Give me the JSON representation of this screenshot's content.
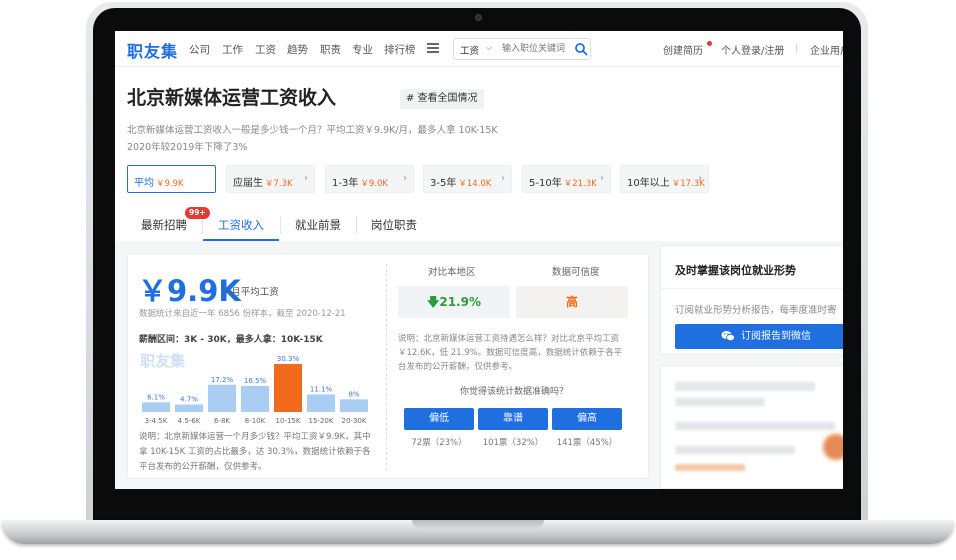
{
  "nav": {
    "logo": "职友集",
    "links": [
      "公司",
      "工作",
      "工资",
      "趋势",
      "职责",
      "专业",
      "排行榜"
    ],
    "search": {
      "category": "工资",
      "placeholder": "输入职位关键词"
    },
    "create_resume": "创建简历",
    "login": "个人登录/注册",
    "divider": "|",
    "enterprise": "企业用户"
  },
  "header": {
    "title": "北京新媒体运营工资收入",
    "national_button": "# 查看全国情况",
    "summary_line1": "北京新媒体运营工资收入一般是多少钱一个月？平均工资￥9.9K/月，最多人拿 10K-15K",
    "summary_line2": "2020年较2019年下降了3%"
  },
  "experience_tabs": [
    {
      "name": "平均",
      "value": "￥9.9K",
      "active": true
    },
    {
      "name": "应届生",
      "value": "￥7.3K"
    },
    {
      "name": "1-3年",
      "value": "￥9.0K"
    },
    {
      "name": "3-5年",
      "value": "￥14.0K"
    },
    {
      "name": "5-10年",
      "value": "￥21.3K"
    },
    {
      "name": "10年以上",
      "value": "￥17.3K"
    }
  ],
  "section_tabs": {
    "items": [
      "最新招聘",
      "工资收入",
      "就业前景",
      "岗位职责"
    ],
    "active_index": 1,
    "badge": "99+"
  },
  "salary": {
    "big_value": "￥9.9K",
    "unit": "/ 月平均工资",
    "sample_note": "数据统计来自近一年 6856 份样本，截至 2020-12-21",
    "range_title": "薪酬区间：3K - 30K，最多人拿：10K-15K",
    "watermark": "职友集",
    "note": "说明：北京新媒体运营一个月多少钱？平均工资￥9.9K，其中拿 10K-15K 工资的占比最多，达 30.3%，数据统计依赖于各平台发布的公开薪酬，仅供参考。"
  },
  "comparison": {
    "local_title": "对比本地区",
    "local_value": "21.9%",
    "local_trend": "down",
    "credibility_title": "数据可信度",
    "credibility_value": "高",
    "note": "说明：北京新媒体运营工资待遇怎么样？对比北京平均工资￥12.6K，低 21.9%。数据可信度高，数据统计依赖于各平台发布的公开薪酬，仅供参考。",
    "poll_question": "你觉得该统计数据准确吗？",
    "poll_options": [
      {
        "label": "偏低",
        "count": "72票（23%）"
      },
      {
        "label": "靠谱",
        "count": "101票（32%）"
      },
      {
        "label": "偏高",
        "count": "141票（45%）"
      }
    ]
  },
  "trend_panel": {
    "title": "及时掌握该岗位就业形势",
    "desc": "订阅就业形势分析报告，每季度准时寄",
    "button": "订阅报告到微信"
  },
  "chart_data": {
    "type": "bar",
    "categories": [
      "3-4.5K",
      "4.5-6K",
      "6-8K",
      "8-10K",
      "10-15K",
      "15-20K",
      "20-30K"
    ],
    "values": [
      6.1,
      4.7,
      17.2,
      16.5,
      30.3,
      11.1,
      8
    ],
    "data_labels": [
      "6.1%",
      "4.7%",
      "17.2%",
      "16.5%",
      "30.3%",
      "11.1%",
      "8%"
    ],
    "highlight_index": 4,
    "colors": {
      "normal": "#a9cdf3",
      "highlight": "#f26b1d"
    }
  },
  "colors": {
    "accent": "#1f6fe0",
    "orange": "#f26b1d",
    "green": "#2a9d3a"
  }
}
